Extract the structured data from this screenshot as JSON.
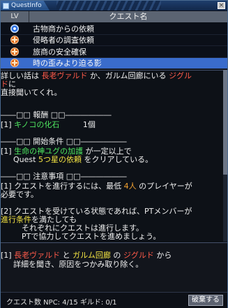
{
  "window": {
    "title": "QuestInfo",
    "close": "×"
  },
  "list": {
    "headers": {
      "lv": "LV",
      "name": "クエスト名"
    },
    "rows": [
      {
        "name": "古物商からの依頼",
        "icon": "blue-circle-icon",
        "selected": false
      },
      {
        "name": "侵略者の調査依頼",
        "icon": "orange-plus-icon",
        "selected": false
      },
      {
        "name": "旅商の安全確保",
        "icon": "orange-plus-icon",
        "selected": false
      },
      {
        "name": "時の歪みより迫る影",
        "icon": "orange-plus-icon",
        "selected": true
      }
    ]
  },
  "detail": {
    "intro": {
      "p1": "詳しい話は",
      "elder": "長老ヴァルド",
      "p2": "か、ガルム回廊にいる",
      "sigurd_1": "ジグル",
      "sigurd_2": "ド",
      "p3": "に",
      "p4": "直接聞いてくれ。"
    },
    "reward": {
      "header": "――□□ 報酬 □□――――――",
      "idx": "[1]",
      "item": "キノコの化石",
      "qty": "1個"
    },
    "start": {
      "header": "――□□ 開始条件 □□――――――",
      "idx": "[1]",
      "cond": "生命の神ユグの加護",
      "cond_suffix": "が一定以上で",
      "line2_a": "Quest",
      "line2_b": "5つ星の依頼",
      "line2_c": "をクリアしている。"
    },
    "notes": {
      "header": "――□□ 注意事項 □□――――――",
      "n1_a": "[1] クエストを進行するには、最低",
      "n1_b": "4人",
      "n1_c": "のプレイヤーが",
      "n1_d": "必要です。",
      "n2_a": "[2] クエストを受けている状態であれば、PTメンバーが",
      "n2_b": "進行条件",
      "n2_c": "を満たしても",
      "n2_d": "それぞれにクエストは進行します。",
      "n2_e": "PTで協力してクエストを進めましょう。"
    }
  },
  "goal": {
    "idx": "[1]",
    "elder": "長老ヴァルド",
    "and": "と",
    "garm": "ガルム回廊",
    "no": "の",
    "sigurd": "ジグルド",
    "from": "から",
    "line2": "詳細を聞き、原因をつかみ取り除く。"
  },
  "footer": {
    "status": "クエスト数 NPC: 4/15  ギルド: 0/1",
    "abandon": "破棄する"
  },
  "colors": {
    "accent_selected": "#3a6ccc",
    "red": "#ff5a4a",
    "green": "#4fe860",
    "yellow": "#f4e442",
    "orange": "#f0a030"
  }
}
